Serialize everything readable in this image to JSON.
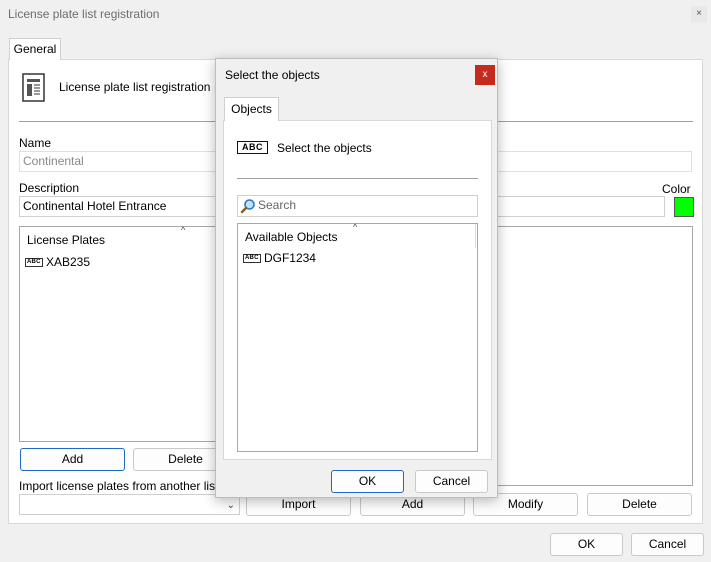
{
  "window": {
    "title": "License plate list registration",
    "close_glyph": "×",
    "tab_general": "General",
    "header_label": "License plate list registration",
    "name_label": "Name",
    "name_value": "Continental",
    "description_label": "Description",
    "description_value": "Continental Hotel Entrance",
    "color_label": "Color",
    "color_value": "#00ff00",
    "license_plates_header": "License Plates",
    "license_plates": [
      {
        "text": "XAB235"
      }
    ],
    "add_label": "Add",
    "delete_label": "Delete",
    "import_label": "Import license plates from another list",
    "import_button": "Import",
    "add2_label": "Add",
    "modify_label": "Modify",
    "delete2_label": "Delete",
    "ok_label": "OK",
    "cancel_label": "Cancel"
  },
  "dialog": {
    "title": "Select the objects",
    "close_glyph": "x",
    "tab_objects": "Objects",
    "header_label": "Select the objects",
    "search_placeholder": "Search",
    "available_header": "Available Objects",
    "available": [
      {
        "text": "DGF1234"
      }
    ],
    "ok_label": "OK",
    "cancel_label": "Cancel"
  },
  "icon_text": {
    "abc": "ABC"
  }
}
